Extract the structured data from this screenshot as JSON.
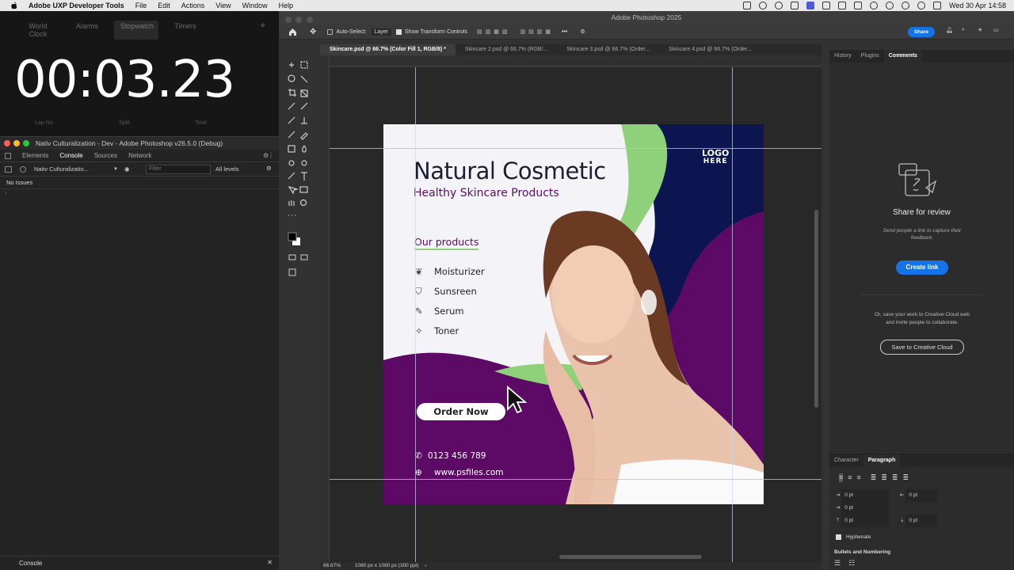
{
  "menubar": {
    "app_name": "Adobe UXP Developer Tools",
    "menus": [
      "File",
      "Edit",
      "Actions",
      "View",
      "Window",
      "Help"
    ],
    "clock": "Wed 30 Apr  14:58"
  },
  "clock_app": {
    "tabs": [
      "World Clock",
      "Alarms",
      "Stopwatch",
      "Timers"
    ],
    "time": "00:03.23",
    "columns": [
      "Lap No.",
      "Split",
      "Total"
    ]
  },
  "devtools": {
    "title": "Nativ Culturalization - Dev - Adobe Photoshop v26.5.0 (Debug)",
    "tabs": [
      "Elements",
      "Console",
      "Sources",
      "Network"
    ],
    "context": "Nativ Culturalizatio...",
    "filter_placeholder": "Filter",
    "levels": "All levels",
    "issues": "No Issues",
    "footer": "Console"
  },
  "photoshop": {
    "title": "Adobe Photoshop 2025",
    "options": {
      "auto_select": "Auto-Select:",
      "layer": "Layer",
      "show_transform": "Show Transform Controls",
      "share": "Share"
    },
    "doc_tabs": [
      "Skincare.psd @ 66.7% (Color Fill 1, RGB/8) *",
      "Skincare 2.psd @ 66.7% (RGB/...",
      "Skincare 3.psd @ 66.7% (Order...",
      "Skincare 4.psd @ 66.7% (Order..."
    ],
    "status_zoom": "66.67%",
    "status_doc": "1080 px x 1080 px (300 ppi)"
  },
  "artwork": {
    "title": "Natural Cosmetic",
    "subtitle": "Healthy Skincare Products",
    "logo_line1": "LOGO",
    "logo_line2": "HERE",
    "products_heading": "Our products",
    "products": [
      "Moisturizer",
      "Sunsreen",
      "Serum",
      "Toner"
    ],
    "order_button": "Order Now",
    "phone": "0123 456 789",
    "website": "www.psfiles.com",
    "colors": {
      "purple": "#5c0a66",
      "navy": "#0c1550",
      "green": "#8fd07a",
      "bg": "#f4f4f8"
    }
  },
  "right_panel": {
    "tabs": [
      "History",
      "Plugins",
      "Comments"
    ],
    "share_title": "Share for review",
    "share_desc": "Send people a link to capture their feedback.",
    "create_link": "Create link",
    "save_desc": "Or, save your work to Creative Cloud web and invite people to collaborate.",
    "save_button": "Save to Creative Cloud",
    "bottom_tabs": [
      "Character",
      "Paragraph"
    ],
    "pt_values": [
      "0 pt",
      "0 pt",
      "0 pt",
      "0 pt",
      "0 pt"
    ],
    "hyphenate": "Hyphenate",
    "bullets": "Bullets and Numbering"
  }
}
